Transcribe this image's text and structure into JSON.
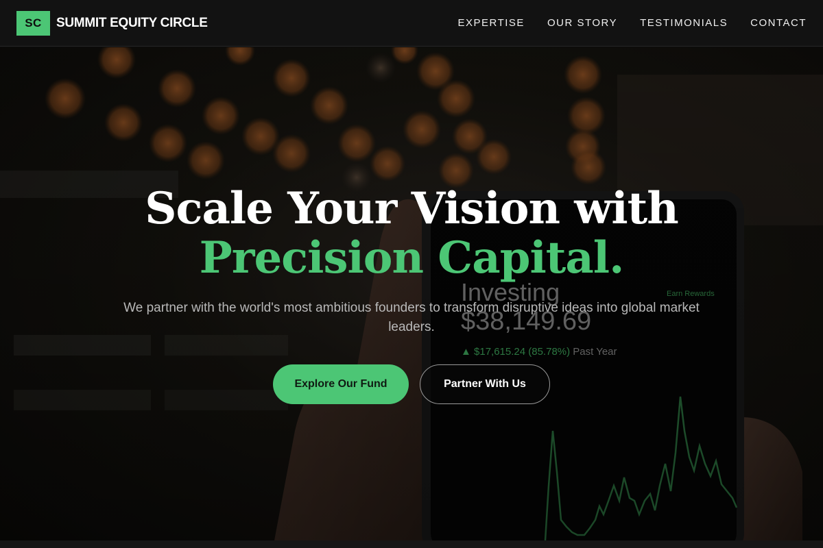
{
  "brand": {
    "logo_text": "SC",
    "name": "SUMMIT EQUITY CIRCLE",
    "accent_color": "#4cc675"
  },
  "nav": {
    "links": [
      "EXPERTISE",
      "OUR STORY",
      "TESTIMONIALS",
      "CONTACT"
    ]
  },
  "hero": {
    "headline_line1": "Scale Your Vision with",
    "headline_line2": "Precision Capital.",
    "subtitle": "We partner with the world's most ambitious founders to transform disruptive ideas into global market leaders.",
    "primary_button": "Explore Our Fund",
    "secondary_button": "Partner With Us"
  },
  "background_phone": {
    "label": "Investing",
    "balance": "$38,149.69",
    "change": "$17,615.24 (85.78%)",
    "period": "Past Year",
    "rewards": "Earn Rewards",
    "chart_color": "#3fa85c"
  }
}
